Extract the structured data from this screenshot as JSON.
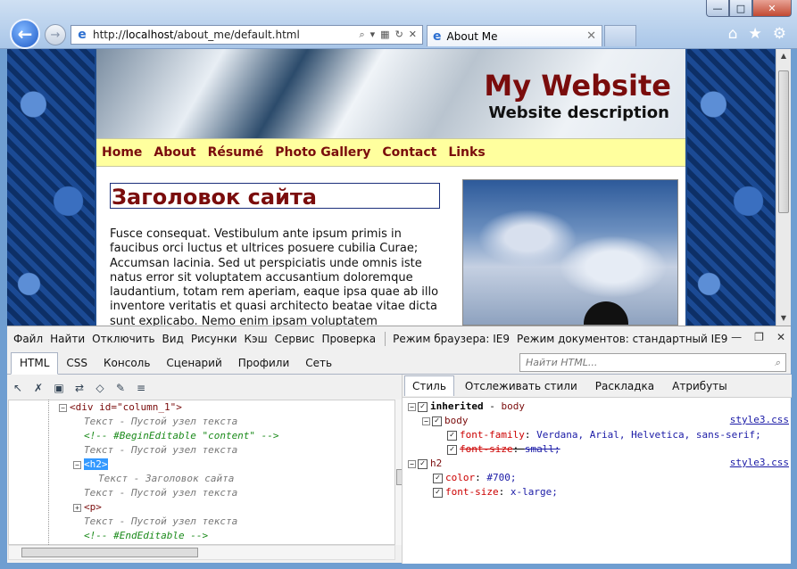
{
  "window": {
    "controls": {
      "min": "—",
      "max": "□",
      "close": "✕"
    },
    "address": {
      "prefix": "http://",
      "host": "localhost",
      "path": "/about_me/default.html"
    },
    "tab_title": "About Me"
  },
  "site": {
    "title": "My Website",
    "description": "Website description",
    "nav": [
      "Home",
      "About",
      "Résumé",
      "Photo Gallery",
      "Contact",
      "Links"
    ],
    "heading": "Заголовок сайта",
    "paragraph": "Fusce consequat. Vestibulum ante ipsum primis in faucibus orci luctus et ultrices posuere cubilia Curae; Accumsan lacinia. Sed ut perspiciatis unde omnis iste natus error sit voluptatem accusantium doloremque laudantium, totam rem aperiam, eaque ipsa quae ab illo inventore veritatis et quasi architecto beatae vitae dicta sunt explicabo. Nemo enim ipsam voluptatem"
  },
  "devtools": {
    "menu": [
      "Файл",
      "Найти",
      "Отключить",
      "Вид",
      "Рисунки",
      "Кэш",
      "Сервис",
      "Проверка"
    ],
    "browser_mode": "Режим браузера: IE9",
    "doc_mode": "Режим документов: стандартный IE9",
    "tabs": [
      "HTML",
      "CSS",
      "Консоль",
      "Сценарий",
      "Профили",
      "Сеть"
    ],
    "search_placeholder": "Найти HTML...",
    "tree": {
      "line0_tag": "<div id=\"column_1\">",
      "empty_text": "Текст - Пустой узел текста",
      "comment_begin": "<!--  #BeginEditable \"content\"  -->",
      "h2_tag": "<h2>",
      "h2_text": "Текст - Заголовок сайта",
      "p_tag": "<p>",
      "comment_end": "<!--  #EndEditable  -->"
    },
    "style_tabs": [
      "Стиль",
      "Отслеживать стили",
      "Раскладка",
      "Атрибуты"
    ],
    "styles": {
      "inherited": "inherited",
      "dash": " - ",
      "body": "body",
      "font_family_prop": "font-family",
      "font_family_val": "Verdana, Arial, Helvetica, sans-serif;",
      "font_size_prop": "font-size",
      "font_size_small": "small;",
      "h2": "h2",
      "color_prop": "color",
      "color_val": "#700;",
      "font_size_xlarge": "x-large;",
      "source": "style3.css"
    }
  }
}
